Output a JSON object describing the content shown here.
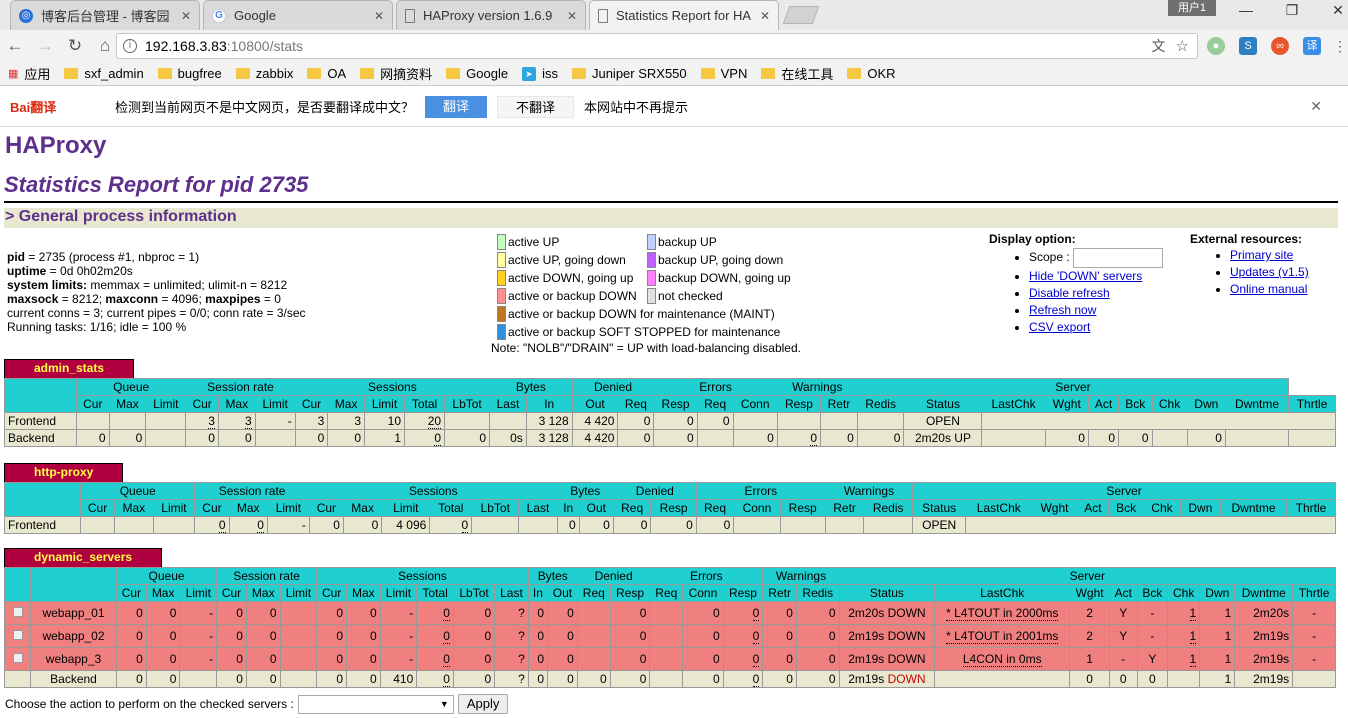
{
  "browser": {
    "tabs": [
      {
        "title": "博客后台管理 - 博客园",
        "icon": "cnblogs-icon"
      },
      {
        "title": "Google",
        "icon": "google-icon"
      },
      {
        "title": "HAProxy version 1.6.9",
        "icon": "document-icon"
      },
      {
        "title": "Statistics Report for HA",
        "icon": "document-icon"
      }
    ],
    "user_label": "用户1",
    "url_host": "192.168.3.83",
    "url_path": ":10800/stats",
    "bookmarks": [
      "应用",
      "sxf_admin",
      "bugfree",
      "zabbix",
      "OA",
      "网摘资料",
      "Google",
      "iss",
      "Juniper SRX550",
      "VPN",
      "在线工具",
      "OKR"
    ]
  },
  "translate_bar": {
    "brand": "Bai翻译",
    "question": "检测到当前网页不是中文网页，是否要翻译成中文？",
    "translate": "翻译",
    "no_translate": "不翻译",
    "never": "本网站中不再提示"
  },
  "header": {
    "title": "HAProxy",
    "subtitle": "Statistics Report for pid 2735",
    "section": "> General process information"
  },
  "info": {
    "l1_label": "pid",
    "l1_val": " = 2735 (process #1, nbproc = 1)",
    "l2_label": "uptime",
    "l2_val": " = 0d 0h02m20s",
    "l3_label": "system limits:",
    "l3_val": " memmax = unlimited; ulimit-n = 8212",
    "l4_a": "maxsock",
    "l4_b": " = 8212; ",
    "l4_c": "maxconn",
    "l4_d": " = 4096; ",
    "l4_e": "maxpipes",
    "l4_f": " = 0",
    "l5": "current conns = 3; current pipes = 0/0; conn rate = 3/sec",
    "l6": "Running tasks: 1/16; idle = 100 %"
  },
  "legend": {
    "left": [
      {
        "label": "active UP",
        "color": "#c0ffc0"
      },
      {
        "label": "active UP, going down",
        "color": "#ffffa0"
      },
      {
        "label": "active DOWN, going up",
        "color": "#ffd020"
      },
      {
        "label": "active or backup DOWN",
        "color": "#ff9090"
      }
    ],
    "right": [
      {
        "label": "backup UP",
        "color": "#c0d0ff"
      },
      {
        "label": "backup UP, going down",
        "color": "#c060ff"
      },
      {
        "label": "backup DOWN, going up",
        "color": "#ff80ff"
      },
      {
        "label": "not checked",
        "color": "#e0e0e0"
      }
    ],
    "wide": [
      {
        "label": "active or backup DOWN for maintenance (MAINT)",
        "color": "#c07820"
      },
      {
        "label": "active or backup SOFT STOPPED for maintenance",
        "color": "#3090e0"
      }
    ],
    "note": "Note: \"NOLB\"/\"DRAIN\" = UP with load-balancing disabled."
  },
  "display": {
    "title": "Display option:",
    "scope": "Scope :",
    "links": [
      "Hide 'DOWN' servers",
      "Disable refresh",
      "Refresh now",
      "CSV export"
    ]
  },
  "external": {
    "title": "External resources:",
    "links": [
      "Primary site",
      "Updates (v1.5)",
      "Online manual"
    ]
  },
  "groups": {
    "queue": "Queue",
    "rate": "Session rate",
    "sessions": "Sessions",
    "bytes": "Bytes",
    "denied": "Denied",
    "errors": "Errors",
    "warnings": "Warnings",
    "server": "Server"
  },
  "cols": {
    "cur": "Cur",
    "max": "Max",
    "limit": "Limit",
    "total": "Total",
    "lbtot": "LbTot",
    "last": "Last",
    "in": "In",
    "out": "Out",
    "req": "Req",
    "resp": "Resp",
    "conn": "Conn",
    "retr": "Retr",
    "redis": "Redis",
    "status": "Status",
    "lastchk": "LastChk",
    "wght": "Wght",
    "act": "Act",
    "bck": "Bck",
    "chk": "Chk",
    "dwn": "Dwn",
    "dwntme": "Dwntme",
    "thrtle": "Thrtle"
  },
  "proxies": [
    {
      "name": "admin_stats",
      "frontend": {
        "label": "Frontend",
        "r_cur": "3",
        "r_max": "3",
        "r_lim": "-",
        "s_cur": "3",
        "s_max": "3",
        "s_lim": "10",
        "s_tot": "20",
        "b_in": "3 128",
        "b_out": "4 420",
        "d_req": "0",
        "d_resp": "0",
        "e_req": "0",
        "status": "OPEN"
      },
      "backend": {
        "label": "Backend",
        "q_cur": "0",
        "q_max": "0",
        "r_cur": "0",
        "r_max": "0",
        "s_cur": "0",
        "s_max": "0",
        "s_lim": "1",
        "s_tot": "0",
        "s_lbt": "0",
        "s_last": "0s",
        "b_in": "3 128",
        "b_out": "4 420",
        "d_req": "0",
        "d_resp": "0",
        "e_conn": "0",
        "e_resp": "0",
        "w_retr": "0",
        "w_redis": "0",
        "status": "2m20s UP",
        "wght": "0",
        "act": "0",
        "bck": "0",
        "dwn": "0"
      }
    },
    {
      "name": "http-proxy",
      "frontend": {
        "label": "Frontend",
        "r_cur": "0",
        "r_max": "0",
        "r_lim": "-",
        "s_cur": "0",
        "s_max": "0",
        "s_lim": "4 096",
        "s_tot": "0",
        "b_in": "0",
        "b_out": "0",
        "d_req": "0",
        "d_resp": "0",
        "e_req": "0",
        "status": "OPEN"
      }
    },
    {
      "name": "dynamic_servers",
      "servers": [
        {
          "name": "webapp_01",
          "q_cur": "0",
          "q_max": "0",
          "q_lim": "-",
          "r_cur": "0",
          "r_max": "0",
          "s_cur": "0",
          "s_max": "0",
          "s_lim": "-",
          "s_tot": "0",
          "s_lbt": "0",
          "s_last": "?",
          "b_in": "0",
          "b_out": "0",
          "d_resp": "0",
          "e_conn": "0",
          "e_resp": "0",
          "w_retr": "0",
          "w_redis": "0",
          "status": "2m20s DOWN",
          "lastchk": "* L4TOUT in 2000ms",
          "wght": "2",
          "act": "Y",
          "bck": "-",
          "chk": "1",
          "dwn": "1",
          "dwntme": "2m20s",
          "thr": "-"
        },
        {
          "name": "webapp_02",
          "q_cur": "0",
          "q_max": "0",
          "q_lim": "-",
          "r_cur": "0",
          "r_max": "0",
          "s_cur": "0",
          "s_max": "0",
          "s_lim": "-",
          "s_tot": "0",
          "s_lbt": "0",
          "s_last": "?",
          "b_in": "0",
          "b_out": "0",
          "d_resp": "0",
          "e_conn": "0",
          "e_resp": "0",
          "w_retr": "0",
          "w_redis": "0",
          "status": "2m19s DOWN",
          "lastchk": "* L4TOUT in 2001ms",
          "wght": "2",
          "act": "Y",
          "bck": "-",
          "chk": "1",
          "dwn": "1",
          "dwntme": "2m19s",
          "thr": "-"
        },
        {
          "name": "webapp_3",
          "q_cur": "0",
          "q_max": "0",
          "q_lim": "-",
          "r_cur": "0",
          "r_max": "0",
          "s_cur": "0",
          "s_max": "0",
          "s_lim": "-",
          "s_tot": "0",
          "s_lbt": "0",
          "s_last": "?",
          "b_in": "0",
          "b_out": "0",
          "d_resp": "0",
          "e_conn": "0",
          "e_resp": "0",
          "w_retr": "0",
          "w_redis": "0",
          "status": "2m19s DOWN",
          "lastchk": "L4CON in 0ms",
          "wght": "1",
          "act": "-",
          "bck": "Y",
          "chk": "1",
          "dwn": "1",
          "dwntme": "2m19s",
          "thr": "-"
        }
      ],
      "backend": {
        "label": "Backend",
        "q_cur": "0",
        "q_max": "0",
        "r_cur": "0",
        "r_max": "0",
        "s_cur": "0",
        "s_max": "0",
        "s_lim": "410",
        "s_tot": "0",
        "s_lbt": "0",
        "s_last": "?",
        "b_in": "0",
        "b_out": "0",
        "d_req": "0",
        "d_resp": "0",
        "e_conn": "0",
        "e_resp": "0",
        "w_retr": "0",
        "w_redis": "0",
        "status_time": "2m19s ",
        "status_word": "DOWN",
        "wght": "0",
        "act": "0",
        "bck": "0",
        "dwn": "1",
        "dwntme": "2m19s"
      }
    }
  ],
  "actions": {
    "label": "Choose the action to perform on the checked servers :",
    "apply": "Apply"
  }
}
